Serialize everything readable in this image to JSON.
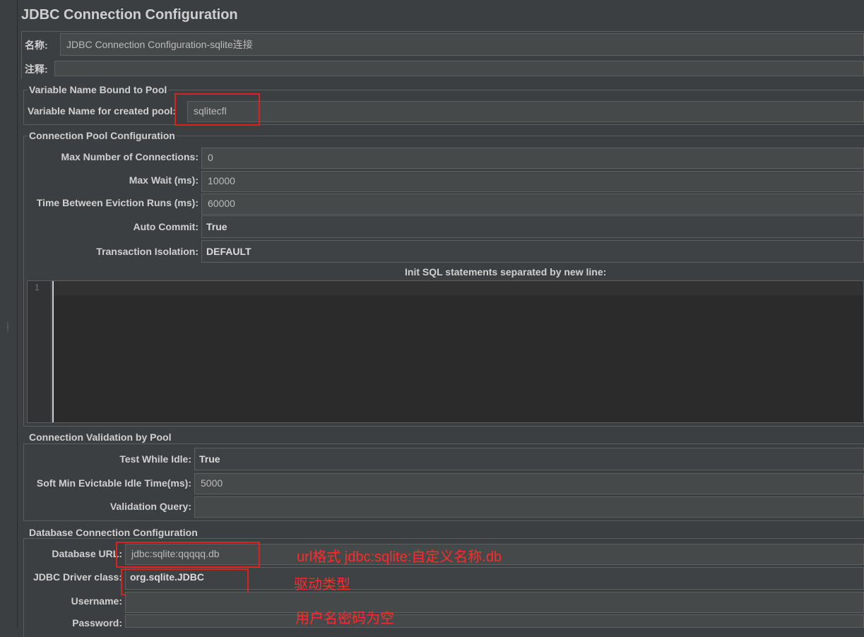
{
  "title": "JDBC Connection Configuration",
  "name": {
    "label": "名称:",
    "value": "JDBC Connection Configuration-sqlite连接"
  },
  "comments": {
    "label": "注释:",
    "value": ""
  },
  "variable_section": {
    "legend": "Variable Name Bound to Pool",
    "pool_var": {
      "label": "Variable Name for created pool:",
      "value": "sqlitecfl"
    }
  },
  "pool_section": {
    "legend": "Connection Pool Configuration",
    "max_connections": {
      "label": "Max Number of Connections:",
      "value": "0"
    },
    "max_wait": {
      "label": "Max Wait (ms):",
      "value": "10000"
    },
    "eviction_runs": {
      "label": "Time Between Eviction Runs (ms):",
      "value": "60000"
    },
    "auto_commit": {
      "label": "Auto Commit:",
      "value": "True"
    },
    "isolation": {
      "label": "Transaction Isolation:",
      "value": "DEFAULT"
    },
    "init_sql_label": "Init SQL statements separated by new line:",
    "editor_line": "1"
  },
  "validation_section": {
    "legend": "Connection Validation by Pool",
    "test_idle": {
      "label": "Test While Idle:",
      "value": "True"
    },
    "soft_min": {
      "label": "Soft Min Evictable Idle Time(ms):",
      "value": "5000"
    },
    "validation_query": {
      "label": "Validation Query:",
      "value": ""
    }
  },
  "db_section": {
    "legend": "Database Connection Configuration",
    "url": {
      "label": "Database URL:",
      "value": "jdbc:sqlite:qqqqq.db"
    },
    "driver": {
      "label": "JDBC Driver class:",
      "value": "org.sqlite.JDBC"
    },
    "username": {
      "label": "Username:",
      "value": ""
    },
    "password": {
      "label": "Password:",
      "value": ""
    }
  },
  "annotations": {
    "url_note": "url格式  jdbc:sqlite:自定义名称.db",
    "driver_note": "驱动类型",
    "cred_note": "用户名密码为空"
  },
  "colors": {
    "highlight": "#e0201e",
    "annotation_text": "#ff2a2a",
    "background": "#3c3f41",
    "field": "#45494a"
  }
}
